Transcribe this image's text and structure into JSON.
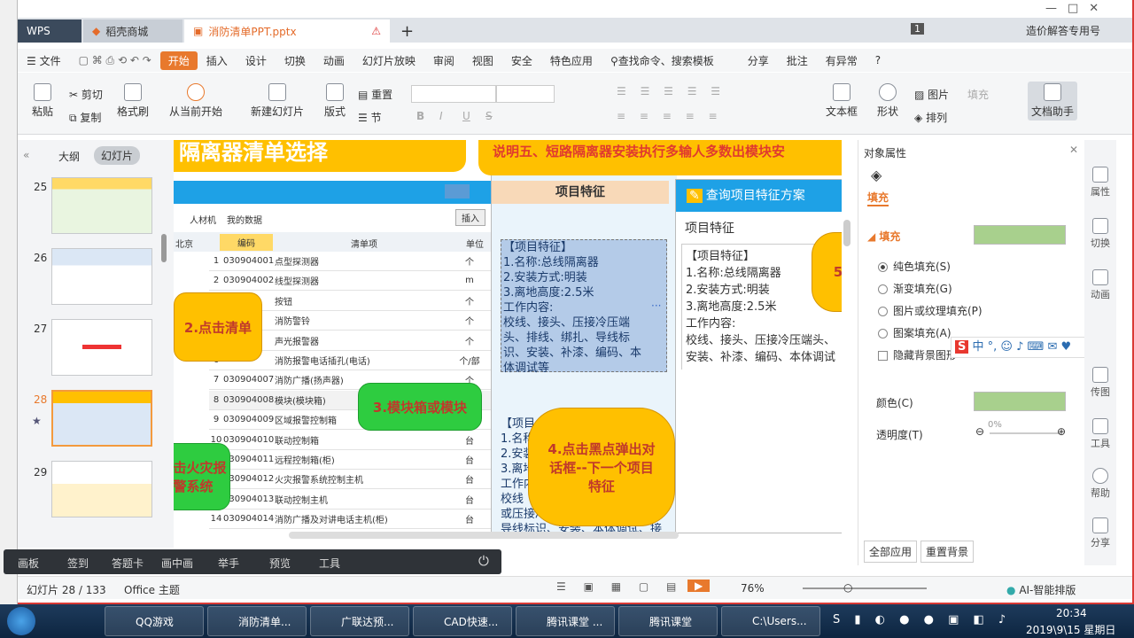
{
  "tabs": {
    "wps": "WPS",
    "store": "稻壳商城",
    "doc": "消防清单PPT.pptx",
    "right_label": "造价解答专用号",
    "badge": "1"
  },
  "menu": [
    "文件",
    "开始",
    "插入",
    "设计",
    "切换",
    "动画",
    "幻灯片放映",
    "审阅",
    "视图",
    "安全",
    "特色应用"
  ],
  "search": "查找命令、搜索模板",
  "menu_right": [
    "分享",
    "批注",
    "有异常"
  ],
  "ribbon": {
    "paste": "粘贴",
    "cut": "剪切",
    "copy": "复制",
    "fmt": "格式刷",
    "from_current": "从当前开始",
    "new_slide": "新建幻灯片",
    "layout": "版式",
    "reset": "重置",
    "section": "节",
    "textbox": "文本框",
    "shape": "形状",
    "arrange": "排列",
    "picture": "图片",
    "fill": "填充",
    "assistant": "文档助手",
    "bold": "B",
    "italic": "I",
    "underline": "U",
    "strike": "S"
  },
  "panel": {
    "outline": "大纲",
    "slides": "幻灯片"
  },
  "slides": [
    {
      "n": "25"
    },
    {
      "n": "26"
    },
    {
      "n": "27"
    },
    {
      "n": "28"
    },
    {
      "n": "29"
    }
  ],
  "slide": {
    "title_left": "隔离器清单选择",
    "title_right": "说明五、短路隔离器安装执行多输人多数出模块安",
    "sheet_tabs": [
      "人材机",
      "我的数据"
    ],
    "insert": "插入",
    "col_code": "编码",
    "col_name": "清单项",
    "col_unit": "单位",
    "col_filter": "北京",
    "rows": [
      {
        "i": "1",
        "code": "030904001",
        "name": "点型探测器",
        "unit": "个"
      },
      {
        "i": "2",
        "code": "030904002",
        "name": "线型探测器",
        "unit": "m"
      },
      {
        "i": "3",
        "code": "",
        "name": "按钮",
        "unit": "个"
      },
      {
        "i": "4",
        "code": "",
        "name": "消防警铃",
        "unit": "个"
      },
      {
        "i": "5",
        "code": "",
        "name": "声光报警器",
        "unit": "个"
      },
      {
        "i": "6",
        "code": "",
        "name": "消防报警电话插孔(电话)",
        "unit": "个/部"
      },
      {
        "i": "7",
        "code": "030904007",
        "name": "消防广播(扬声器)",
        "unit": "个"
      },
      {
        "i": "8",
        "code": "030904008",
        "name": "模块(模块箱)",
        "unit": "个"
      },
      {
        "i": "9",
        "code": "030904009",
        "name": "区域报警控制箱",
        "unit": "台"
      },
      {
        "i": "10",
        "code": "030904010",
        "name": "联动控制箱",
        "unit": "台"
      },
      {
        "i": "11",
        "code": "030904011",
        "name": "远程控制箱(柜)",
        "unit": "台"
      },
      {
        "i": "12",
        "code": "030904012",
        "name": "火灾报警系统控制主机",
        "unit": "台"
      },
      {
        "i": "13",
        "code": "030904013",
        "name": "联动控制主机",
        "unit": "台"
      },
      {
        "i": "14",
        "code": "030904014",
        "name": "消防广播及对讲电话主机(柜)",
        "unit": "台"
      }
    ],
    "feature_header": "项目特征",
    "feature_lines": [
      "【项目特征】",
      "1.名称:总线隔离器",
      "2.安装方式:明装",
      "3.离地高度:2.5米",
      "工作内容:",
      "校线、接头、压接冷压端",
      "头、排线、绑扎、导线标",
      "识、安装、补漆、编码、本",
      "体调试等"
    ],
    "lower_lines": [
      "【项目",
      "1.名称",
      "2.安装",
      "3.离地",
      "工作内",
      "校线",
      "或压接冷压端头、排线、绑扎、",
      "导线标识、安装、本体调试、接"
    ],
    "dialog_title": "查询项目特征方案",
    "dialog_sub": "项目特征",
    "dialog_lines": [
      "【项目特征】",
      "1.名称:总线隔离器",
      "2.安装方式:明装",
      "3.离地高度:2.5米",
      "工作内容:",
      "校线、接头、压接冷压端头、",
      "安装、补漆、编码、本体调试"
    ],
    "callout2": "2.点击清单",
    "callout3": "3.模块箱或模块",
    "callout4": "4.点击黑点弹出对话框--下一个项目特征",
    "callout_left": "点击火灾报警系统",
    "callout_right": "5"
  },
  "props": {
    "title": "对象属性",
    "tab": "填充",
    "section": "填充",
    "opts": [
      "纯色填充(S)",
      "渐变填充(G)",
      "图片或纹理填充(P)",
      "图案填充(A)"
    ],
    "hide_bg": "隐藏背景图形",
    "color": "颜色(C)",
    "transparency": "透明度(T)",
    "pct": "0%",
    "apply_all": "全部应用",
    "reset_bg": "重置背景"
  },
  "rside": [
    "属性",
    "切换",
    "动画",
    "传图",
    "工具",
    "帮助",
    "分享"
  ],
  "classbar": [
    "画板",
    "签到",
    "答题卡",
    "画中画",
    "举手",
    "预览",
    "工具"
  ],
  "status": {
    "slide": "幻灯片 28 / 133",
    "theme": "Office 主题",
    "zoom": "76%",
    "ai": "AI-智能排版"
  },
  "ime": "中",
  "taskbar": [
    "QQ游戏",
    "消防清单...",
    "广联达预...",
    "CAD快速...",
    "腾讯课堂 ...",
    "腾讯课堂",
    "C:\\Users..."
  ],
  "clock": {
    "time": "20:34",
    "date": "2019\\9\\15 星期日"
  },
  "colors": {
    "accent": "#e8792d",
    "callout_yellow": "#ffc000",
    "callout_green": "#2ecc40",
    "fill": "#a8d08d",
    "dialog": "#1ea1e6"
  }
}
